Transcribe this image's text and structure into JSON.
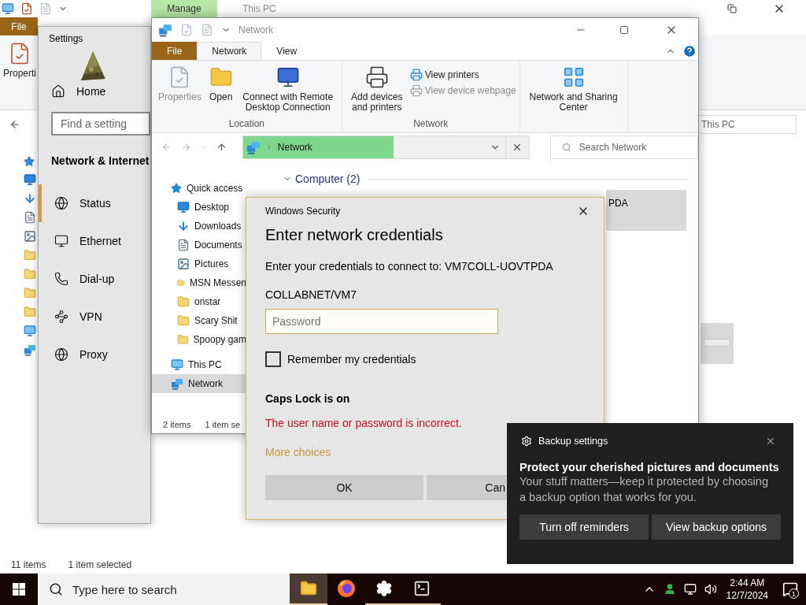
{
  "desktop_window": {
    "title": "This PC",
    "context_tab": "Manage",
    "file_tab": "File",
    "ribbon_button": "Properti",
    "address": "This PC",
    "status_count": "11 items",
    "status_selection": "1 item selected"
  },
  "settings_window": {
    "title": "Settings",
    "home": "Home",
    "search": {
      "placeholder": "Find a setting"
    },
    "heading": "Network & Internet",
    "items": [
      {
        "label": "Status",
        "kind": "status",
        "selected": true
      },
      {
        "label": "Ethernet",
        "kind": "ethernet",
        "selected": false
      },
      {
        "label": "Dial-up",
        "kind": "dialup",
        "selected": false
      },
      {
        "label": "VPN",
        "kind": "vpn",
        "selected": false
      },
      {
        "label": "Proxy",
        "kind": "proxy",
        "selected": false
      }
    ]
  },
  "explorer": {
    "title": "Network",
    "tabs": [
      {
        "label": "File",
        "kind": "file",
        "selected": false
      },
      {
        "label": "Network",
        "kind": "tab",
        "selected": true
      },
      {
        "label": "View",
        "kind": "tab",
        "selected": false
      }
    ],
    "ribbon_groups": [
      {
        "label": "Location",
        "buttons": [
          {
            "label": "Properties",
            "kind": "properties",
            "disabled": true
          },
          {
            "label": "Open",
            "kind": "open",
            "disabled": false
          },
          {
            "label": "Connect with Remote Desktop Connection",
            "kind": "remote",
            "disabled": false
          }
        ]
      },
      {
        "label": "Network",
        "buttons": [
          {
            "label": "Add devices and printers",
            "kind": "printers",
            "disabled": false
          }
        ],
        "links": [
          {
            "label": "View printers",
            "disabled": false
          },
          {
            "label": "View device webpage",
            "disabled": true
          }
        ]
      },
      {
        "buttons": [
          {
            "label": "Network and Sharing Center",
            "kind": "sharing",
            "disabled": false
          }
        ]
      }
    ],
    "address": "Network",
    "search": {
      "placeholder": "Search Network"
    },
    "nav": [
      {
        "label": "Quick access",
        "kind": "star",
        "selected": false,
        "children": [
          {
            "label": "Desktop",
            "kind": "desktop",
            "selected": false
          },
          {
            "label": "Downloads",
            "kind": "downloads",
            "selected": false
          },
          {
            "label": "Documents",
            "kind": "documents",
            "selected": false
          },
          {
            "label": "Pictures",
            "kind": "pictures",
            "selected": false
          },
          {
            "label": "MSN Messen",
            "kind": "folder",
            "selected": false
          },
          {
            "label": "onstar",
            "kind": "folder",
            "selected": false
          },
          {
            "label": "Scary Shit",
            "kind": "folder",
            "selected": false
          },
          {
            "label": "Spoopy gam",
            "kind": "folder",
            "selected": false
          }
        ]
      },
      {
        "label": "This PC",
        "kind": "pc",
        "selected": false
      },
      {
        "label": "Network",
        "kind": "network",
        "selected": true
      }
    ],
    "group_header": "Computer (2)",
    "tile": "PDA",
    "status_count": "2 items",
    "status_selection": "1 item se"
  },
  "dialog": {
    "caption": "Windows Security",
    "title": "Enter network credentials",
    "message": "Enter your credentials to connect to: VM7COLL-UOVTPDA",
    "user": "COLLABNET/VM7",
    "password": {
      "placeholder": "Password"
    },
    "remember": {
      "label": "Remember my credentials",
      "checked": false
    },
    "caps_warning": "Caps Lock is on",
    "error": "The user name or password is incorrect.",
    "more_choices": "More choices",
    "buttons": [
      "OK",
      "Can"
    ]
  },
  "toast": {
    "app": "Backup settings",
    "title": "Protect your cherished pictures and documents",
    "body": "Your stuff matters—keep it protected by choosing a backup option that works for you.",
    "buttons": [
      "Turn off reminders",
      "View backup options"
    ]
  },
  "taskbar": {
    "search": {
      "placeholder": "Type here to search"
    },
    "apps": [
      {
        "kind": "explorer",
        "open": true,
        "selected": true
      },
      {
        "kind": "firefox",
        "open": false,
        "selected": false
      },
      {
        "kind": "settings",
        "open": true,
        "selected": false
      },
      {
        "kind": "terminal",
        "open": true,
        "selected": false
      }
    ],
    "time": "2:44 AM",
    "date": "12/7/2024",
    "notifications": "1"
  }
}
